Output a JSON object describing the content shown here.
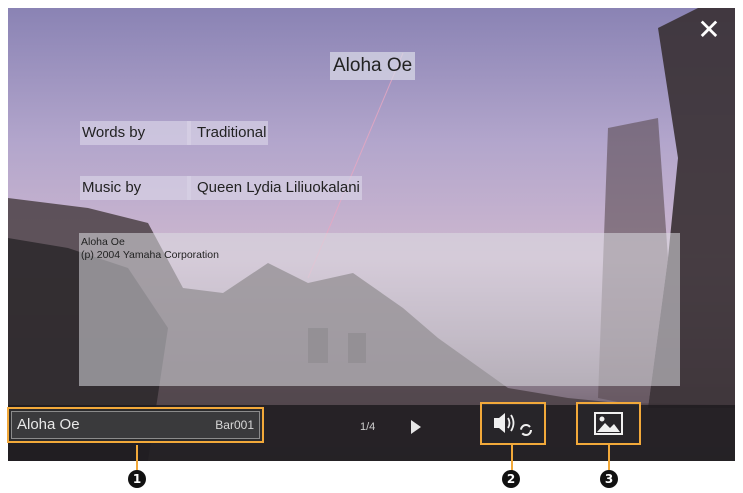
{
  "window": {
    "close_icon": "close-icon"
  },
  "song_info": {
    "title": "Aloha Oe",
    "words_label": "Words by",
    "words_value": "Traditional",
    "music_label": "Music by",
    "music_value": "Queen Lydia Liliuokalani",
    "lyrics_lines": [
      "Aloha Oe",
      "(p) 2004 Yamaha Corporation"
    ]
  },
  "bottom_bar": {
    "song_name": "Aloha Oe",
    "bar_position": "Bar001",
    "page_indicator": "1/4",
    "next_icon": "play-right-icon",
    "audio_icon": "speaker-repeat-icon",
    "image_icon": "image-icon"
  },
  "callouts": [
    "1",
    "2",
    "3"
  ],
  "colors": {
    "highlight_border": "#f2a93a",
    "bar_background": "#1e1c20"
  }
}
